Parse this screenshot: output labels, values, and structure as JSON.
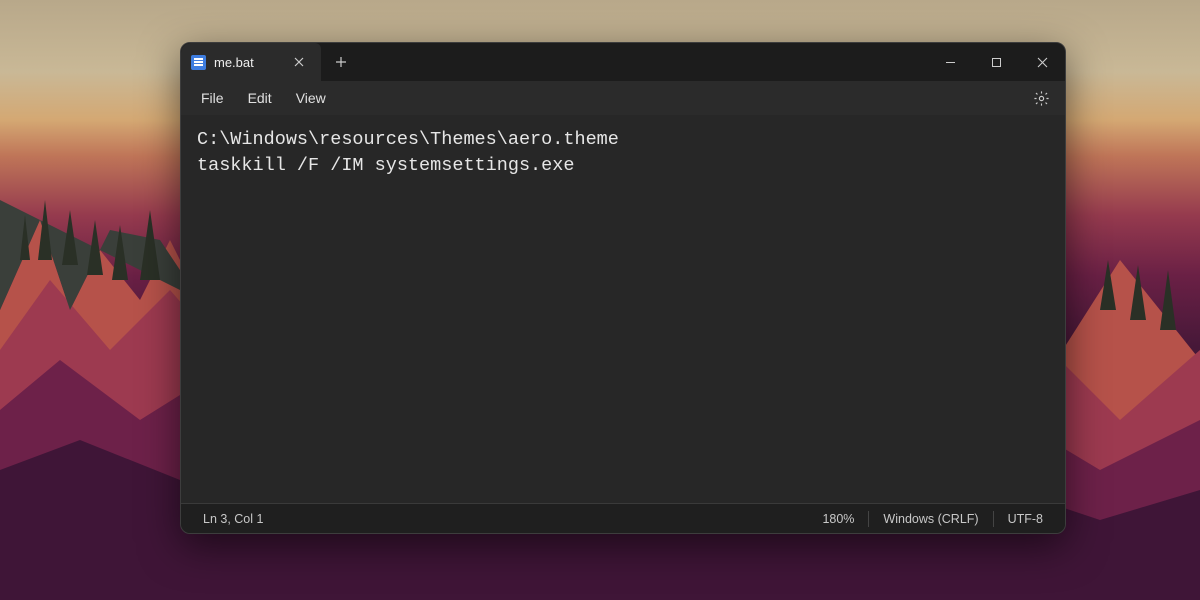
{
  "tab": {
    "title": "me.bat"
  },
  "menu": {
    "file": "File",
    "edit": "Edit",
    "view": "View"
  },
  "editor": {
    "content": "C:\\Windows\\resources\\Themes\\aero.theme\ntaskkill /F /IM systemsettings.exe"
  },
  "status": {
    "cursor": "Ln 3, Col 1",
    "zoom": "180%",
    "line_ending": "Windows (CRLF)",
    "encoding": "UTF-8"
  }
}
